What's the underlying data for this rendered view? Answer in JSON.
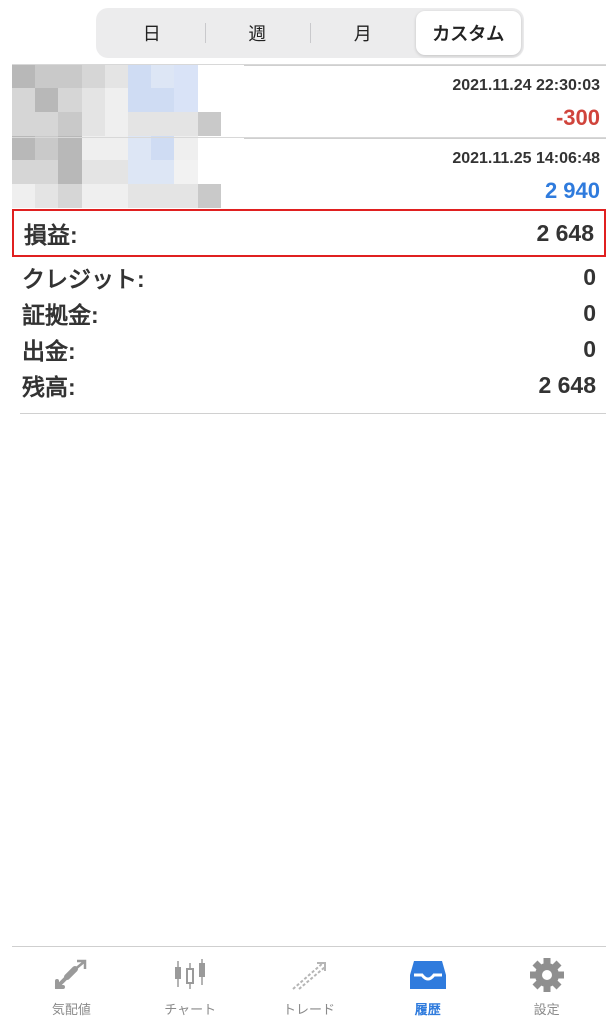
{
  "segments": [
    {
      "label": "日"
    },
    {
      "label": "週"
    },
    {
      "label": "月"
    },
    {
      "label": "カスタム"
    }
  ],
  "active_segment": "カスタム",
  "deals": [
    {
      "time": "2021.11.24 22:30:03",
      "profit": "-300",
      "sign": "negative"
    },
    {
      "time": "2021.11.25 14:06:48",
      "profit": "2 940",
      "sign": "positive"
    }
  ],
  "summary": {
    "profit_label": "損益:",
    "profit_value": "2 648",
    "credit_label": "クレジット:",
    "credit_value": "0",
    "margin_label": "証拠金:",
    "margin_value": "0",
    "withdrawal_label": "出金:",
    "withdrawal_value": "0",
    "balance_label": "残高:",
    "balance_value": "2 648"
  },
  "tabs": [
    {
      "label": "気配値",
      "icon": "quotes-icon"
    },
    {
      "label": "チャート",
      "icon": "candlestick-icon"
    },
    {
      "label": "トレード",
      "icon": "trade-icon"
    },
    {
      "label": "履歴",
      "icon": "inbox-icon"
    },
    {
      "label": "設定",
      "icon": "gear-icon"
    }
  ],
  "active_tab": "履歴",
  "colors": {
    "negative": "#d0443c",
    "positive": "#2f7bdd",
    "highlight_border": "#e02020",
    "active_tab": "#2f7bdd",
    "inactive_tab": "#8a8a8a"
  }
}
